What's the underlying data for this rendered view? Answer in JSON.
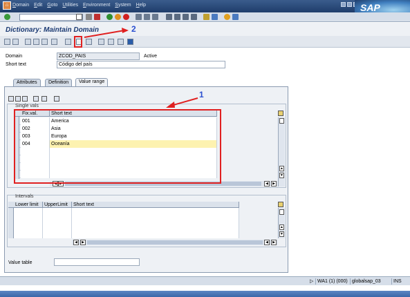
{
  "menubar": {
    "items": [
      {
        "label": "Domain"
      },
      {
        "label": "Edit"
      },
      {
        "label": "Goto"
      },
      {
        "label": "Utilities"
      },
      {
        "label": "Environment"
      },
      {
        "label": "System"
      },
      {
        "label": "Help"
      }
    ],
    "brand": "SAP"
  },
  "title": "Dictionary: Maintain Domain",
  "header": {
    "domain_label": "Domain",
    "domain_value": "ZCOD_PAIS",
    "status": "Active",
    "short_text_label": "Short text",
    "short_text_value": "Código del país"
  },
  "tabs": [
    {
      "label": "Attributes"
    },
    {
      "label": "Definition"
    },
    {
      "label": "Value range"
    }
  ],
  "single_vals": {
    "title": "Single vals",
    "col_fixval": "Fix.val.",
    "col_short": "Short text",
    "rows": [
      {
        "fixval": "001",
        "text": "America"
      },
      {
        "fixval": "002",
        "text": "Asia"
      },
      {
        "fixval": "003",
        "text": "Europa"
      },
      {
        "fixval": "004",
        "text": "Oceanía"
      }
    ]
  },
  "intervals": {
    "title": "Intervals",
    "col_lower": "Lower limit",
    "col_upper": "UpperLimit",
    "col_short": "Short text"
  },
  "value_table_label": "Value table",
  "statusbar": {
    "system": "WA1 (1) (000)",
    "server": "globalsap_03",
    "mode": "INS"
  },
  "annotations": {
    "label1": "1",
    "label2": "2",
    "color": "#e02020",
    "number_color": "#2a4fd0"
  }
}
